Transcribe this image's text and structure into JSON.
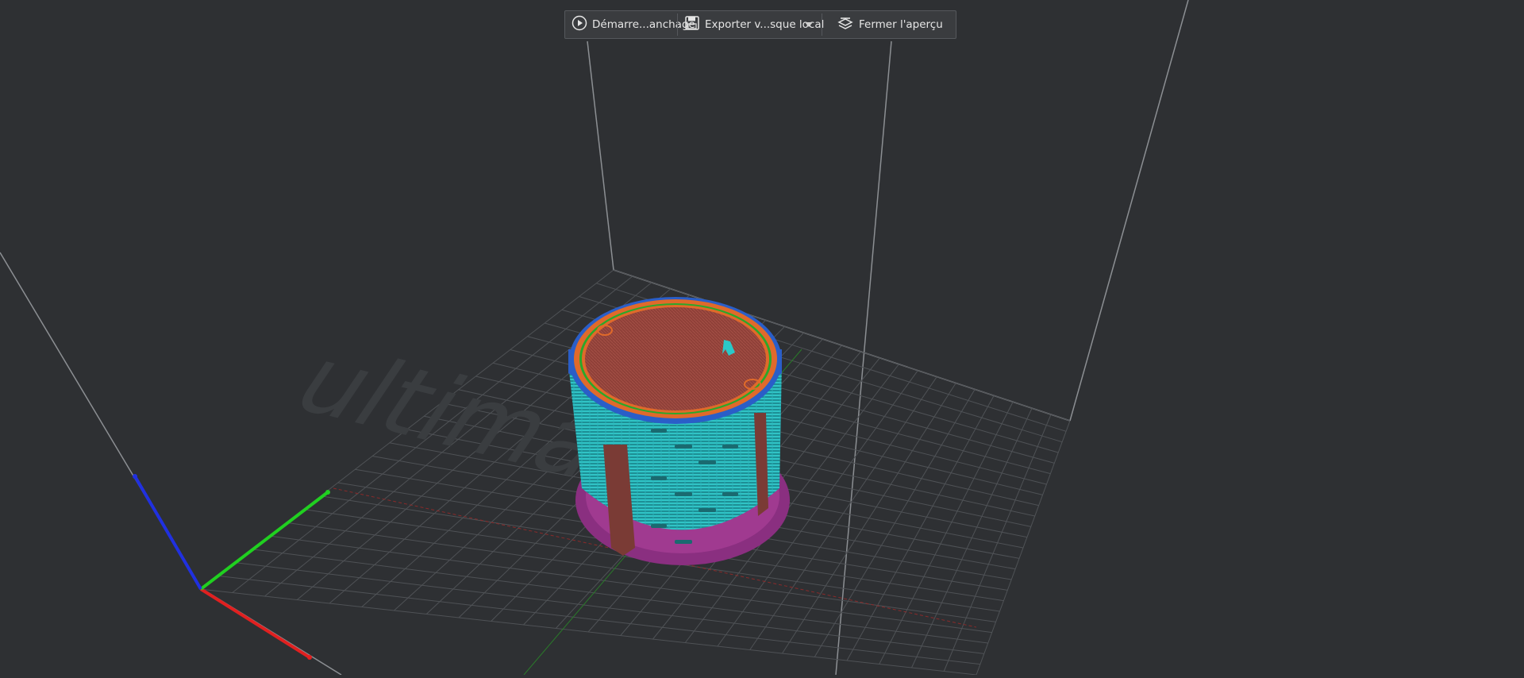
{
  "toolbar": {
    "start_label": "Démarre...anchage",
    "export_label": "Exporter v...sque local",
    "close_preview_label": "Fermer l'aperçu",
    "start_icon": "play-circle-icon",
    "export_icon": "save-disk-icon",
    "export_dropdown_icon": "chevron-down-icon",
    "close_preview_icon": "layers-icon"
  },
  "viewport": {
    "watermark": "ultimaker",
    "colors": {
      "background": "#2e3033",
      "grid": "#4f5256",
      "axis_x": "#e02020",
      "axis_y": "#20d020",
      "axis_z": "#2030e0",
      "top_surface": "#9a4a40",
      "wall_outer": "#e06a2a",
      "wall_inner": "#2aa82a",
      "infill": "#2ac8c8",
      "support": "#2a6ad8",
      "brim": "#a03a90"
    }
  }
}
